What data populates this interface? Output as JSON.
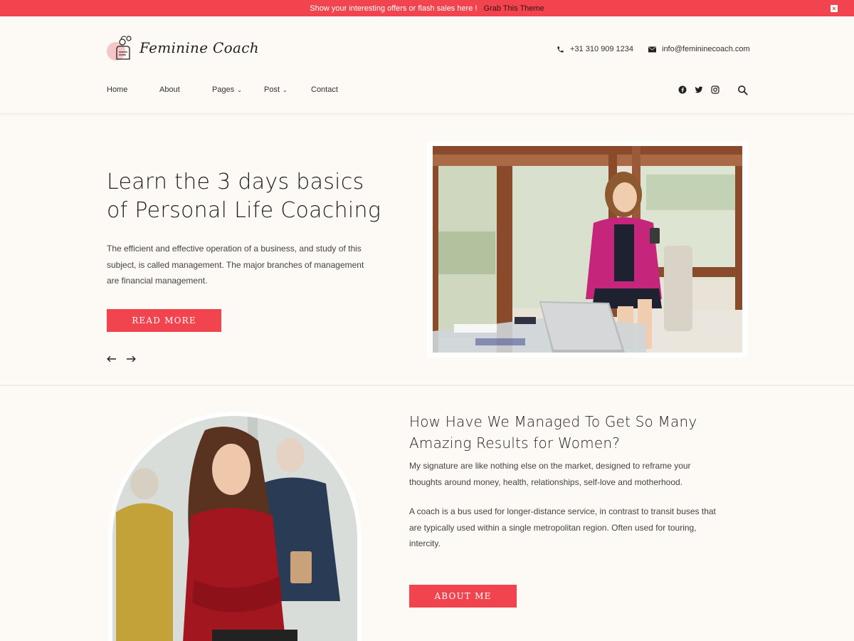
{
  "topbar": {
    "promo_text": "Show your interesting offers or flash sales here !",
    "promo_link": "Grab This Theme",
    "close_label": "×",
    "bg_color": "#f2444f"
  },
  "header": {
    "logo_text": "Feminine Coach",
    "phone": "+31 310 909 1234",
    "email": "info@femininecoach.com",
    "nav": [
      {
        "label": "Home"
      },
      {
        "label": "About"
      },
      {
        "label": "Pages"
      },
      {
        "label": "Post"
      },
      {
        "label": "Contact"
      }
    ],
    "social_icons": [
      "facebook-icon",
      "twitter-icon",
      "instagram-icon"
    ],
    "search_icon": "search-icon"
  },
  "hero": {
    "title_line1": "Learn the 3 days basics",
    "title_line2": "of Personal Life Coaching",
    "description": "The efficient and effective operation of a business, and study of this subject, is called management. The major branches of management are financial management.",
    "button": "READ MORE",
    "prev_icon": "arrow-left-icon",
    "next_icon": "arrow-right-icon"
  },
  "about": {
    "title_line1": "How Have We Managed To Get So Many",
    "title_line2": "Amazing Results for Women?",
    "paragraph1": "My signature are like nothing else on the market, designed to reframe your thoughts around money, health, relationships, self-love and motherhood.",
    "paragraph2": "A coach is a bus used for longer-distance service, in contrast to transit buses that are typically used within a single metropolitan region. Often used for touring, intercity.",
    "button": "ABOUT ME"
  },
  "colors": {
    "accent": "#f2444f",
    "background": "#fdf9f4"
  }
}
